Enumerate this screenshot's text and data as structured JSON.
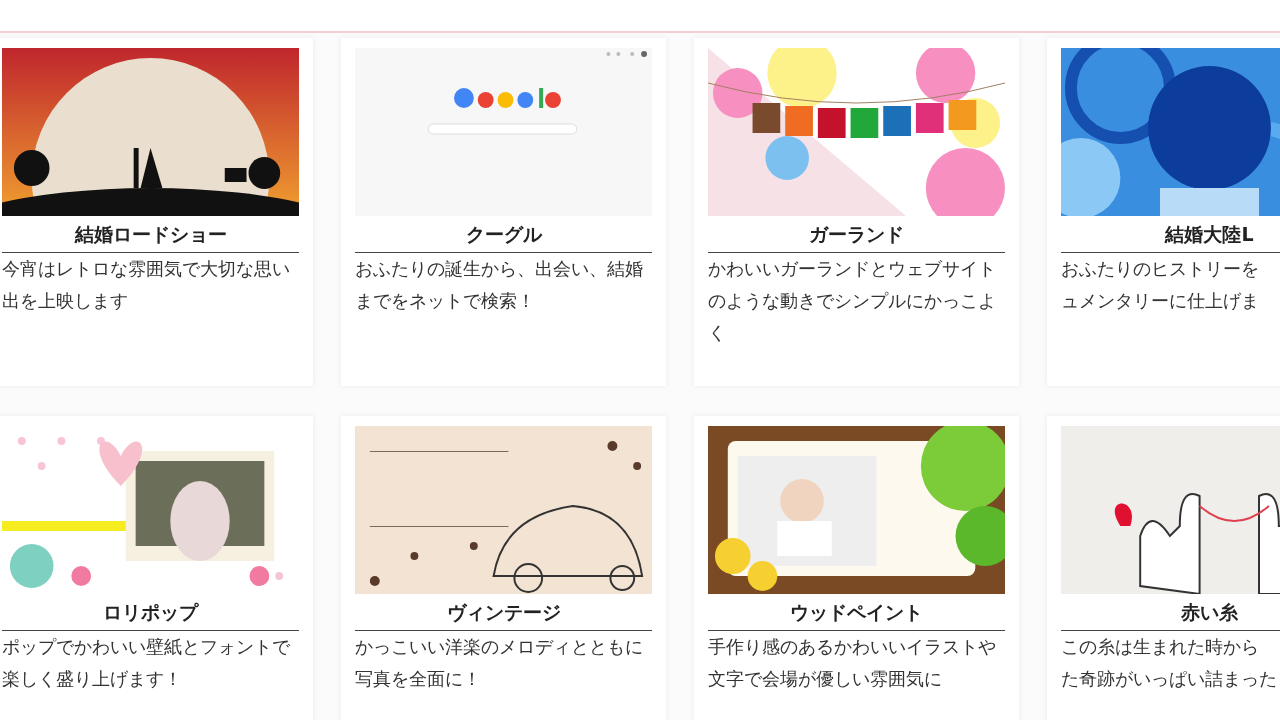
{
  "cards": [
    {
      "kind": "picture",
      "title": "結婚ロードショー",
      "description": [
        "今宵はレトロな雰囲気で大切な思い",
        "出を上映します"
      ]
    },
    {
      "kind": "picture",
      "title": "クーグル",
      "description": [
        "おふたりの誕生から、出会い、結婚",
        "までをネットで検索！"
      ]
    },
    {
      "kind": "picture",
      "title": "ガーランド",
      "description": [
        "かわいいガーランドとウェブサイト",
        "のような動きでシンプルにかっこよ",
        "く"
      ]
    },
    {
      "kind": "picture",
      "title": "結婚大陸L",
      "description": [
        "おふたりのヒストリーを",
        "ュメンタリーに仕上げま"
      ]
    },
    {
      "kind": "picture",
      "title": "ロリポップ",
      "description": [
        "ポップでかわいい壁紙とフォントで",
        "楽しく盛り上げます！"
      ]
    },
    {
      "kind": "picture",
      "title": "ヴィンテージ",
      "description": [
        "かっこいい洋楽のメロディとともに",
        "写真を全面に！"
      ]
    },
    {
      "kind": "picture",
      "title": "ウッドペイント",
      "description": [
        "手作り感のあるかわいいイラストや",
        "文字で会場が優しい雰囲気に"
      ]
    },
    {
      "kind": "picture",
      "title": "赤い糸",
      "description": [
        "この糸は生まれた時から",
        "た奇跡がいっぱい詰まった"
      ]
    }
  ]
}
